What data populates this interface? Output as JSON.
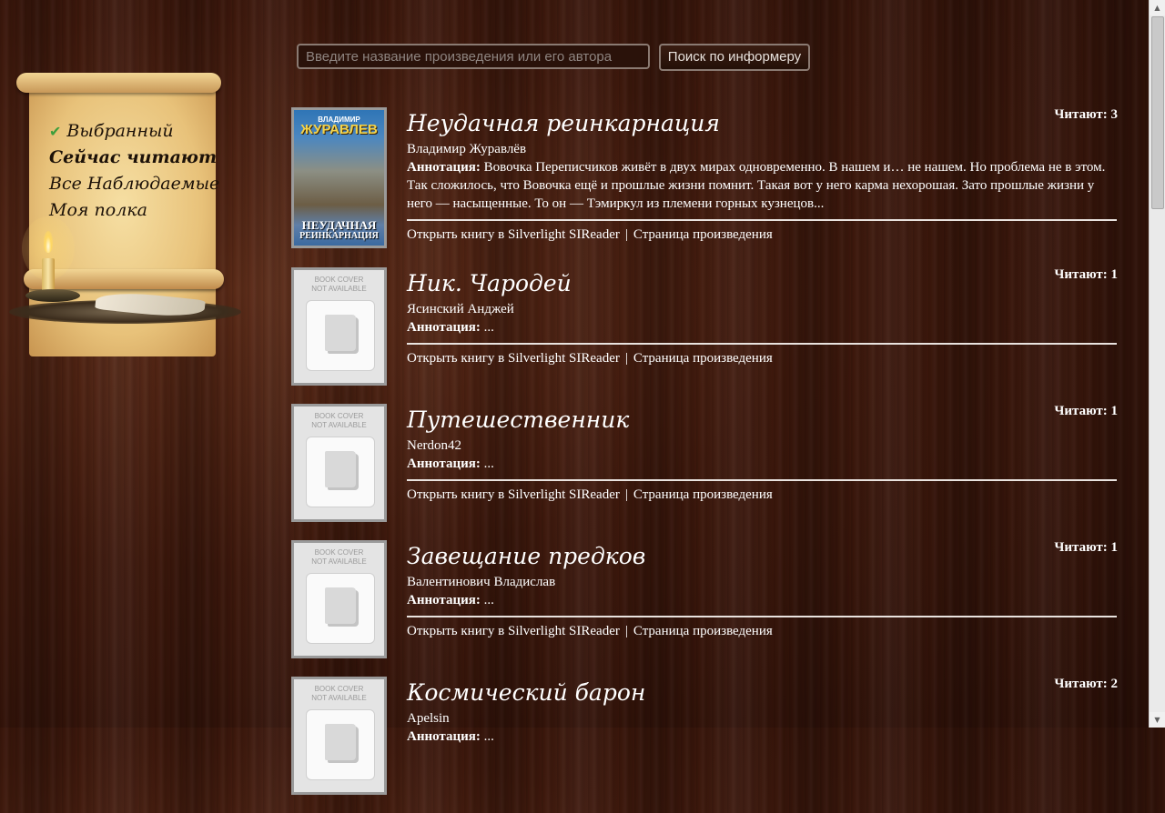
{
  "search": {
    "placeholder": "Введите название произведения или его автора",
    "button_label": "Поиск по информеру"
  },
  "menu": {
    "items": [
      {
        "label": "Выбранный",
        "checked": true
      },
      {
        "label": "Сейчас читают",
        "active": true
      },
      {
        "label": "Все Наблюдаемые"
      },
      {
        "label": "Моя полка"
      }
    ]
  },
  "labels": {
    "annotation_label": "Аннотация:",
    "open_link": "Открыть книгу в Silverlight SIReader",
    "separator": "|",
    "work_page_link": "Страница произведения",
    "reading_prefix": "Читают:",
    "cover_na_line1": "BOOK COVER",
    "cover_na_line2": "NOT AVAILABLE"
  },
  "books": [
    {
      "title": "Неудачная реинкарнация",
      "author": "Владимир Журавлёв",
      "annotation": "Вовочка Переписчиков живёт в двух мирах одновременно. В нашем и… не нашем. Но проблема не в этом. Так сложилось, что Вовочка ещё и прошлые жизни помнит. Такая вот у него карма нехорошая. Зато прошлые жизни у него — насыщенные. То он — Тэмиркул из племени горных кузнецов...",
      "reading": "Читают: 3",
      "cover": {
        "author_small": "ВЛАДИМИР",
        "author_big": "ЖУРАВЛЕВ",
        "title_line1": "НЕУДАЧНАЯ",
        "title_line2": "РЕИНКАРНАЦИЯ"
      }
    },
    {
      "title": "Ник. Чародей",
      "author": "Ясинский Анджей",
      "annotation": "...",
      "reading": "Читают: 1"
    },
    {
      "title": "Путешественник",
      "author": "Nerdon42",
      "annotation": "...",
      "reading": "Читают: 1"
    },
    {
      "title": "Завещание предков",
      "author": "Валентинович Владислав",
      "annotation": "...",
      "reading": "Читают: 1"
    },
    {
      "title": "Космический барон",
      "author": "Apelsin",
      "annotation": "...",
      "reading": "Читают: 2"
    }
  ]
}
